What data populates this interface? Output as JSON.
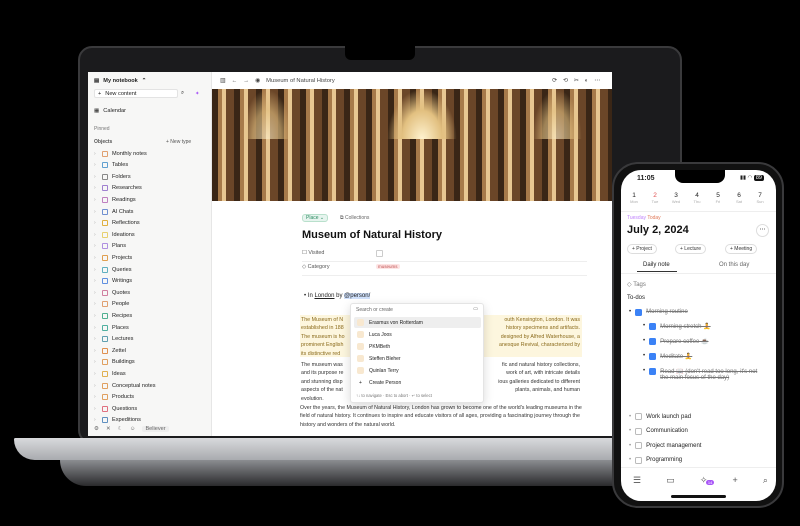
{
  "laptop": {
    "sidebar": {
      "notebook": "My notebook",
      "new_content": "New content",
      "calendar": "Calendar",
      "pinned": "Pinned",
      "objects": "Objects",
      "new_type": "+ New type",
      "items": [
        {
          "label": "Monthly notes",
          "color": "#e0a070"
        },
        {
          "label": "Tables",
          "color": "#60a0d0"
        },
        {
          "label": "Folders",
          "color": "#888888"
        },
        {
          "label": "Researches",
          "color": "#a080d0"
        },
        {
          "label": "Readings",
          "color": "#c080c0"
        },
        {
          "label": "AI Chats",
          "color": "#7090d0"
        },
        {
          "label": "Reflections",
          "color": "#e0b040"
        },
        {
          "label": "Ideations",
          "color": "#e8d070"
        },
        {
          "label": "Plans",
          "color": "#b090e0"
        },
        {
          "label": "Projects",
          "color": "#e0a050"
        },
        {
          "label": "Queries",
          "color": "#60b0c0"
        },
        {
          "label": "Writings",
          "color": "#6090e0"
        },
        {
          "label": "Quotes",
          "color": "#d080a0"
        },
        {
          "label": "People",
          "color": "#e0a070"
        },
        {
          "label": "Recipes",
          "color": "#50b090"
        },
        {
          "label": "Places",
          "color": "#50b0a0"
        },
        {
          "label": "Lectures",
          "color": "#60a0b0"
        },
        {
          "label": "Zettel",
          "color": "#e09050"
        },
        {
          "label": "Buildings",
          "color": "#e0a060"
        },
        {
          "label": "Ideas",
          "color": "#e0b050"
        },
        {
          "label": "Conceptual notes",
          "color": "#e0a060"
        },
        {
          "label": "Products",
          "color": "#e0a060"
        },
        {
          "label": "Questions",
          "color": "#e07080"
        },
        {
          "label": "Expeditions",
          "color": "#6090c0"
        }
      ],
      "footer_user": "Believer"
    },
    "topbar": {
      "breadcrumb": "Museum of Natural History"
    },
    "page": {
      "type_tag": "Place",
      "collections": "Collections",
      "title": "Museum of Natural History",
      "props": [
        {
          "label": "Visited",
          "value": ""
        },
        {
          "label": "Category",
          "value": "museums"
        }
      ],
      "bullet": {
        "pre": "In ",
        "link": "London",
        "mid": " by ",
        "mention": "@person/"
      },
      "para1": [
        "The Museum of N",
        "outh Kensington, London. It was",
        "established in 188",
        " history specimens and artifacts.",
        "The museum is ho",
        "designed by Alfred Waterhouse, a",
        "prominent English",
        "anesque Revival, characterized by",
        "its distinctive red"
      ],
      "para2": [
        "The museum was",
        "fic and natural history collections,",
        "and its purpose re",
        " work of art, with intricate details",
        "and stunning disp",
        "ious galleries dedicated to different",
        "aspects of the nat",
        "plants, animals, and human",
        "evolution."
      ],
      "para3": "Over the years, the Museum of Natural History, London has grown to become one of the world's leading museums in the field of natural history. It continues to inspire and educate visitors of all ages, providing a fascinating journey through the history and wonders of the natural world."
    },
    "popup": {
      "placeholder": "Search or create",
      "people": [
        "Erasmus von Rotterdam",
        "Luca Joos",
        "PKMBeth",
        "Steffen Bleher",
        "Quinlan Terry"
      ],
      "create": "Create Person",
      "hint": "↑↓ to navigate · Esc to abort · ↵ to select"
    }
  },
  "phone": {
    "time": "11:05",
    "battery": "89",
    "days": [
      {
        "n": "1",
        "d": "Mon"
      },
      {
        "n": "2",
        "d": "Tue"
      },
      {
        "n": "3",
        "d": "Wed"
      },
      {
        "n": "4",
        "d": "Thu"
      },
      {
        "n": "5",
        "d": "Fri"
      },
      {
        "n": "6",
        "d": "Sat"
      },
      {
        "n": "7",
        "d": "Sun"
      }
    ],
    "weekday": "Tuesday",
    "today": "Today",
    "date": "July 2, 2024",
    "chips": [
      "+ Project",
      "+ Lecture",
      "+ Meeting"
    ],
    "tabs": [
      "Daily note",
      "On this day"
    ],
    "tags": "Tags",
    "todos_heading": "To-dos",
    "routine": {
      "label": "Morning routine",
      "sub": [
        "Morning stretch 🧘",
        "Prepare coffee ☕",
        "Meditate 🧘",
        "Read 📖 (don't read too long, it's not the main focus of the day)"
      ]
    },
    "open": [
      "Work launch pad",
      "Communication",
      "Project management",
      "Programming"
    ],
    "badge": "14"
  },
  "colors": {
    "accent": "#3b82f6",
    "today": "#e05050",
    "purple": "#a855f7"
  }
}
